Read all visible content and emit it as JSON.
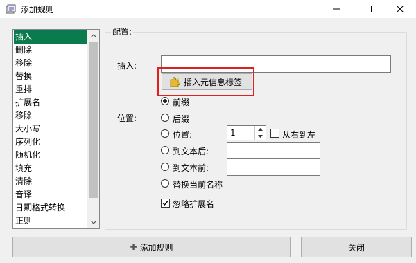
{
  "window": {
    "title": "添加规则"
  },
  "rule_list": {
    "items": [
      "插入",
      "删除",
      "移除",
      "替换",
      "重排",
      "扩展名",
      "移除",
      "大小写",
      "序列化",
      "随机化",
      "填充",
      "清除",
      "音译",
      "日期格式转换",
      "正则"
    ],
    "selected": "插入"
  },
  "config": {
    "title": "配置:",
    "insert_label": "插入:",
    "insert_value": "",
    "insert_meta_button": "插入元信息标签",
    "position_label": "位置:",
    "options": {
      "prefix": "前缀",
      "suffix": "后缀",
      "position": "位置:",
      "after_text": "到文本后:",
      "before_text": "到文本前:",
      "replace_name": "替换当前名称"
    },
    "selected_option": "前缀",
    "position_value": "1",
    "right_to_left": "从右到左",
    "right_to_left_checked": false,
    "after_text_value": "",
    "before_text_value": "",
    "ignore_extension": "忽略扩展名",
    "ignore_extension_checked": true
  },
  "buttons": {
    "add": "添加规则",
    "close": "关闭"
  },
  "colors": {
    "selection": "#0a7b4d",
    "highlight": "#e02020"
  }
}
